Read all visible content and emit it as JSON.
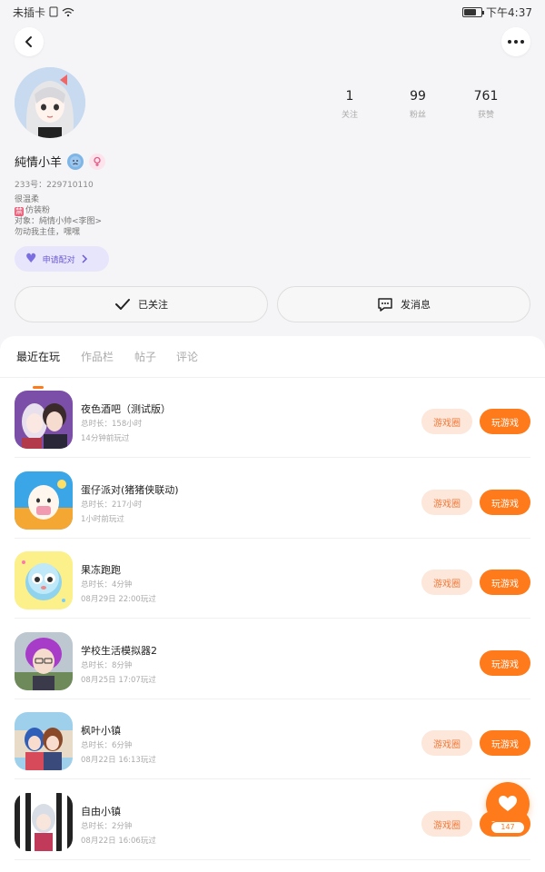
{
  "status_bar": {
    "carrier": "未插卡",
    "time": "下午4:37"
  },
  "profile": {
    "username": "純情小羊",
    "user_id": "233号：229710110",
    "bio_lines": [
      "很温柔",
      "仿装粉",
      "对象：純情小帅<李图>",
      "勿动我主佳，嘿嘿"
    ],
    "pair_label": "申请配对",
    "follow_label": "已关注",
    "message_label": "发消息"
  },
  "stats": [
    {
      "value": "1",
      "label": "关注"
    },
    {
      "value": "99",
      "label": "粉丝"
    },
    {
      "value": "761",
      "label": "获赞"
    }
  ],
  "tabs": [
    "最近在玩",
    "作品栏",
    "帖子",
    "评论"
  ],
  "buttons": {
    "game_circle": "游戏圈",
    "play": "玩游戏"
  },
  "games": [
    {
      "title": "夜色酒吧（测试版）",
      "duration": "总时长：158小时",
      "last_played": "14分钟前玩过",
      "has_circle": true,
      "icon": "anime-couple-icon"
    },
    {
      "title": "蛋仔派对(猪猪侠联动)",
      "duration": "总时长：217小时",
      "last_played": "1小时前玩过",
      "has_circle": true,
      "icon": "eggy-party-icon"
    },
    {
      "title": "果冻跑跑",
      "duration": "总时长：4分钟",
      "last_played": "08月29日 22:00玩过",
      "has_circle": true,
      "icon": "jelly-run-icon"
    },
    {
      "title": "学校生活模拟器2",
      "duration": "总时长：8分钟",
      "last_played": "08月25日 17:07玩过",
      "has_circle": false,
      "icon": "school-sim-icon"
    },
    {
      "title": "枫叶小镇",
      "duration": "总时长：6分钟",
      "last_played": "08月22日 16:13玩过",
      "has_circle": true,
      "icon": "maple-town-icon"
    },
    {
      "title": "自由小镇",
      "duration": "总时长：2分钟",
      "last_played": "08月22日 16:06玩过",
      "has_circle": true,
      "icon": "free-town-icon"
    }
  ],
  "fab": {
    "count": "147"
  },
  "colors": {
    "accent": "#ff7a1a",
    "accent_light": "#fde6da",
    "pair_bg": "#e7e5fb",
    "pair_text": "#6b5bd6"
  }
}
